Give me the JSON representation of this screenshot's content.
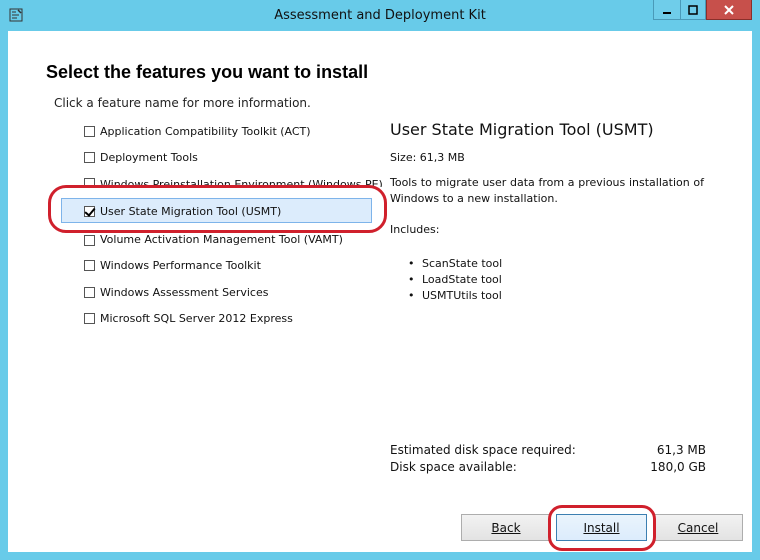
{
  "window": {
    "title": "Assessment and Deployment Kit"
  },
  "page": {
    "heading": "Select the features you want to install",
    "subheading": "Click a feature name for more information."
  },
  "features": [
    {
      "label": "Application Compatibility Toolkit (ACT)",
      "checked": false
    },
    {
      "label": "Deployment Tools",
      "checked": false
    },
    {
      "label": "Windows Preinstallation Environment (Windows PE)",
      "checked": false
    },
    {
      "label": "User State Migration Tool (USMT)",
      "checked": true
    },
    {
      "label": "Volume Activation Management Tool (VAMT)",
      "checked": false
    },
    {
      "label": "Windows Performance Toolkit",
      "checked": false
    },
    {
      "label": "Windows Assessment Services",
      "checked": false
    },
    {
      "label": "Microsoft SQL Server 2012 Express",
      "checked": false
    }
  ],
  "details": {
    "title": "User State Migration Tool (USMT)",
    "size": "Size: 61,3 MB",
    "description": "Tools to migrate user data from a previous installation of Windows to a new installation.",
    "includes_label": "Includes:",
    "tools": [
      "ScanState tool",
      "LoadState tool",
      "USMTUtils tool"
    ]
  },
  "disk": {
    "required_label": "Estimated disk space required:",
    "required_value": "61,3 MB",
    "available_label": "Disk space available:",
    "available_value": "180,0 GB"
  },
  "buttons": {
    "back": "Back",
    "install": "Install",
    "cancel": "Cancel"
  },
  "colors": {
    "frame": "#68cbe9",
    "close": "#c7504b",
    "annotation": "#d0202c"
  }
}
